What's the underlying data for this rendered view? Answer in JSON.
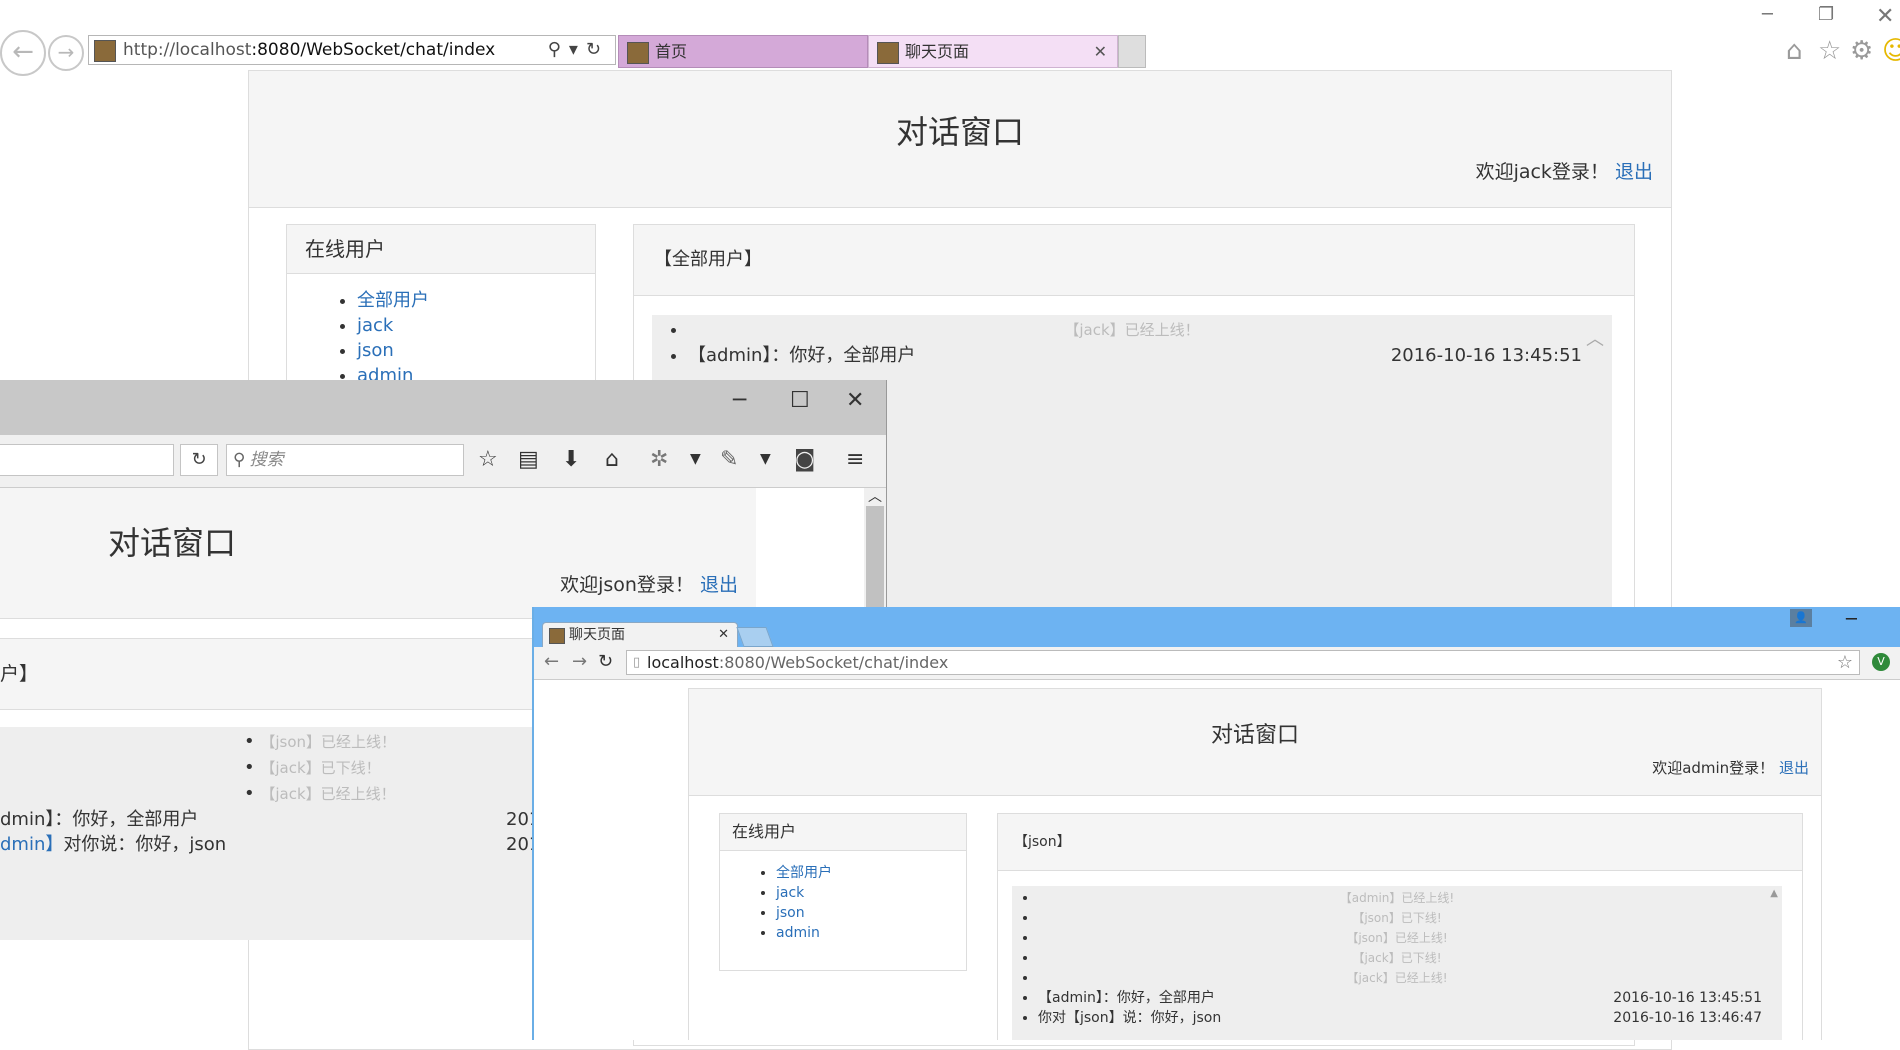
{
  "ie": {
    "url_host": "http://localhost",
    "url_rest": ":8080/WebSocket/chat/index",
    "tabs": [
      {
        "label": "首页"
      },
      {
        "label": "聊天页面"
      }
    ],
    "page": {
      "title": "对话窗口",
      "welcome": "欢迎jack登录！",
      "logout": "退出",
      "users_heading": "在线用户",
      "users": [
        "全部用户",
        "jack",
        "json",
        "admin"
      ],
      "chat_heading": "【全部用户】",
      "messages": [
        {
          "type": "system",
          "text": "【jack】已经上线！"
        },
        {
          "type": "message",
          "text": "【admin】：你好，全部用户",
          "time": "2016-10-16 13:45:51"
        }
      ]
    }
  },
  "ff": {
    "search_placeholder": "搜索",
    "page": {
      "title": "对话窗口",
      "welcome": "欢迎json登录！",
      "logout": "退出",
      "chat_heading": "户】",
      "messages": [
        {
          "type": "system",
          "text": "【json】已经上线！"
        },
        {
          "type": "system",
          "text": "【jack】已下线！"
        },
        {
          "type": "system",
          "text": "【jack】已经上线！"
        },
        {
          "type": "message",
          "text": "dmin】：你好，全部用户",
          "time": "201"
        },
        {
          "type": "message",
          "link": "dmin】",
          "text": "对你说：你好，json",
          "time": "201"
        }
      ]
    }
  },
  "cr": {
    "tab_label": "聊天页面",
    "url_host": "localhost",
    "url_rest": ":8080/WebSocket/chat/index",
    "page": {
      "title": "对话窗口",
      "welcome": "欢迎admin登录！",
      "logout": "退出",
      "users_heading": "在线用户",
      "users": [
        "全部用户",
        "jack",
        "json",
        "admin"
      ],
      "chat_heading": "【json】",
      "messages": [
        {
          "type": "system",
          "text": "【admin】已经上线!"
        },
        {
          "type": "system",
          "text": "【json】已下线!"
        },
        {
          "type": "system",
          "text": "【json】已经上线!"
        },
        {
          "type": "system",
          "text": "【jack】已下线!"
        },
        {
          "type": "system",
          "text": "【jack】已经上线!"
        },
        {
          "type": "message",
          "text": "【admin】：你好，全部用户",
          "time": "2016-10-16 13:45:51"
        },
        {
          "type": "message",
          "text": "你对【json】说：你好，json",
          "time": "2016-10-16 13:46:47"
        }
      ]
    }
  },
  "colors": {
    "link": "#2a6fb8",
    "ie_tab_active": "#d4a9d8",
    "chrome_frame": "#6db3f2",
    "panel_bg": "#f5f5f5",
    "message_bg": "#eeeeee",
    "system_text": "#bcbcbc"
  }
}
